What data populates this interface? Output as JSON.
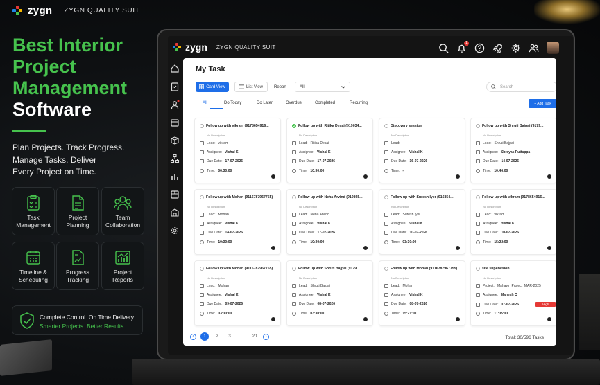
{
  "brand": {
    "name": "zygn",
    "subtitle": "ZYGN QUALITY SUIT",
    "colors": [
      "#e53935",
      "#f5b700",
      "#46c24d",
      "#1e88e5"
    ]
  },
  "hero": {
    "headline_green": [
      "Best Interior",
      "Project",
      "Management"
    ],
    "headline_white": "Software",
    "tagline": [
      "Plan Projects. Track Progress.",
      "Manage Tasks. Deliver",
      "Every Project on Time."
    ],
    "accent": "#46c24d"
  },
  "features": [
    {
      "icon": "clipboard-check-icon",
      "label": [
        "Task",
        "Management"
      ]
    },
    {
      "icon": "document-plan-icon",
      "label": [
        "Project",
        "Planning"
      ]
    },
    {
      "icon": "team-icon",
      "label": [
        "Team",
        "Collaboration"
      ]
    },
    {
      "icon": "calendar-icon",
      "label": [
        "Timeline &",
        "Scheduling"
      ]
    },
    {
      "icon": "progress-document-icon",
      "label": [
        "Progress",
        "Tracking"
      ]
    },
    {
      "icon": "bar-chart-icon",
      "label": [
        "Project",
        "Reports"
      ]
    }
  ],
  "cta": {
    "line1": "Complete Control. On Time Delivery.",
    "line2": "Smarter Projects. Better Results."
  },
  "app": {
    "brand": "zygn",
    "subtitle": "ZYGN QUALITY SUIT",
    "notification_count": "1",
    "topbar_icons": [
      "search-icon",
      "bell-icon",
      "help-icon",
      "rocket-icon",
      "gear-icon",
      "users-icon"
    ],
    "sidebar_icons": [
      "home-icon",
      "clipboard-icon",
      "user-badge-icon",
      "calendar-icon",
      "box-icon",
      "org-chart-icon",
      "chart-icon",
      "package-icon",
      "building-icon",
      "settings-icon"
    ],
    "page_title": "My Task",
    "toolbar": {
      "card_view": "Card View",
      "list_view": "List View",
      "report_label": "Report",
      "report_value": "All",
      "search_placeholder": "Search"
    },
    "tabs": [
      "All",
      "Do Today",
      "Do Later",
      "Overdue",
      "Completed",
      "Recurring"
    ],
    "add_task": "+ Add Task",
    "labels": {
      "lead": "Lead:",
      "assignee": "Assignee:",
      "due": "Due Date:",
      "time": "Time:",
      "project": "Project:"
    },
    "cards": [
      {
        "title": "Follow up with vikram (9178654916...",
        "desc": "No Description",
        "lead": "vikram",
        "assignee": "Vishal K",
        "due": "17-07-2026",
        "time": "06:30:00"
      },
      {
        "title": "Follow up with Ritika Desai (919034...",
        "desc": "No Description",
        "lead": "Ritika Desai",
        "assignee": "Vishal K",
        "due": "17-07-2026",
        "time": "10:30:00",
        "done": true
      },
      {
        "title": "Discovery session",
        "desc": "No Description",
        "lead": "",
        "assignee": "Vishal K",
        "due": "16-07-2026",
        "time": "-"
      },
      {
        "title": "Follow up with Shruti Bajpai (9179...",
        "desc": "No Description",
        "lead": "Shruti Bajpai",
        "assignee": "Shreyas Puttappa",
        "due": "14-07-2026",
        "time": "10:46:00"
      },
      {
        "title": "Follow up with Mohan (9116787967755)",
        "desc": "No Description",
        "lead": "Mohan",
        "assignee": "Vishal K",
        "due": "14-07-2026",
        "time": "10:30:00"
      },
      {
        "title": "Follow up with Neha Arvind (919865...",
        "desc": "No Description",
        "lead": "Neha Arvind",
        "assignee": "Vishal K",
        "due": "17-07-2026",
        "time": "10:30:00"
      },
      {
        "title": "Follow up with Suresh Iyer (916854...",
        "desc": "No Description",
        "lead": "Suresh Iyer",
        "assignee": "Vishal K",
        "due": "10-07-2026",
        "time": "03:30:00"
      },
      {
        "title": "Follow up with vikram (9178654916...",
        "desc": "No Description",
        "lead": "vikram",
        "assignee": "Vishal K",
        "due": "10-07-2026",
        "time": "15:22:00"
      },
      {
        "title": "Follow up with Mohan (9116787967755)",
        "desc": "No Description",
        "lead": "Mohan",
        "assignee": "Vishal K",
        "due": "09-07-2026",
        "time": "03:30:00"
      },
      {
        "title": "Follow up with Shruti Bajpai (9179...",
        "desc": "No Description",
        "lead": "Shruti Bajpai",
        "assignee": "Vishal K",
        "due": "08-07-2026",
        "time": "03:30:00"
      },
      {
        "title": "Follow up with Mohan (9116787967755)",
        "desc": "No Description",
        "lead": "Mohan",
        "assignee": "Vishal K",
        "due": "08-07-2026",
        "time": "15:21:00"
      },
      {
        "title": "site supervision",
        "desc": "No Description",
        "project": "Mahavir_Project_MAR-2025",
        "assignee": "Mahesh C",
        "due": "07-07-2026",
        "time": "11:05:00",
        "priority": "High"
      }
    ],
    "pagination": {
      "pages": [
        "1",
        "2",
        "3",
        "...",
        "20"
      ],
      "total": "Total: 30/596 Tasks"
    }
  }
}
